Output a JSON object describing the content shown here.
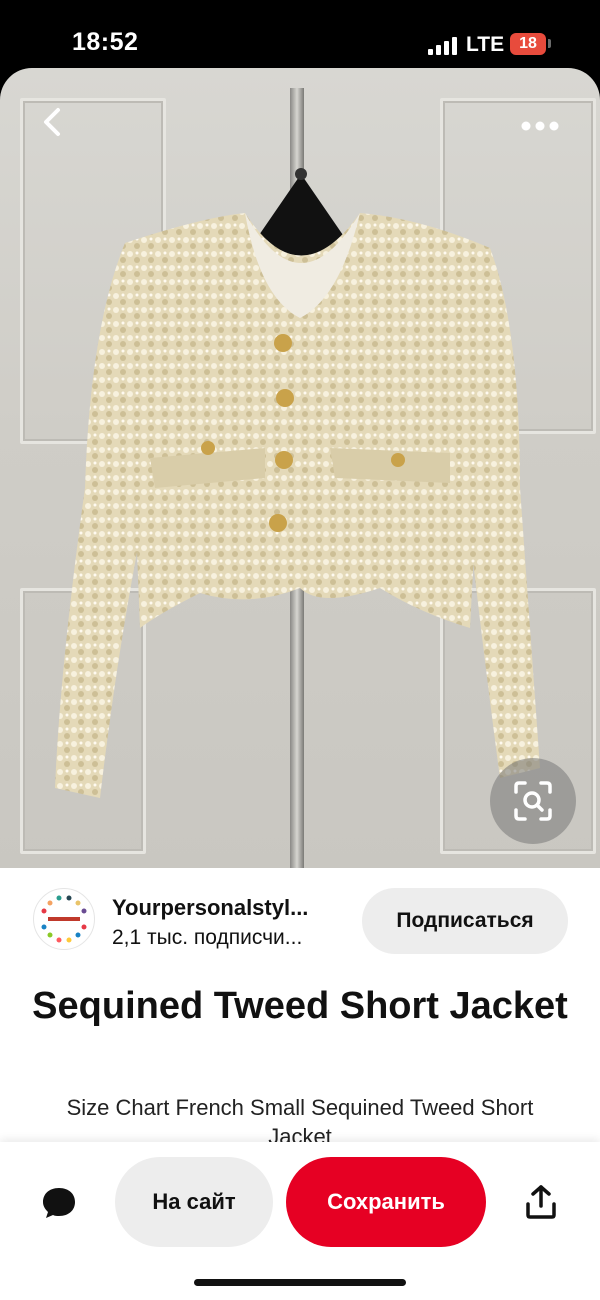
{
  "status_bar": {
    "time": "18:52",
    "network": "LTE",
    "battery": "18",
    "battery_color": "#e84b3c"
  },
  "photo": {
    "icons": {
      "back": "chevron-left-icon",
      "more": "more-horizontal-icon",
      "visual_search": "visual-search-icon"
    }
  },
  "author": {
    "name": "Yourpersonalstyl...",
    "subscribers": "2,1 тыс. подписчи...",
    "subscribe_label": "Подписаться"
  },
  "pin": {
    "title": "Sequined Tweed Short Jacket",
    "description": "Size Chart French Small Sequined Tweed Short Jacket"
  },
  "actions": {
    "visit_label": "На сайт",
    "save_label": "Сохранить",
    "save_color": "#e60023",
    "icons": {
      "comment": "comment-icon",
      "share": "share-icon"
    }
  }
}
